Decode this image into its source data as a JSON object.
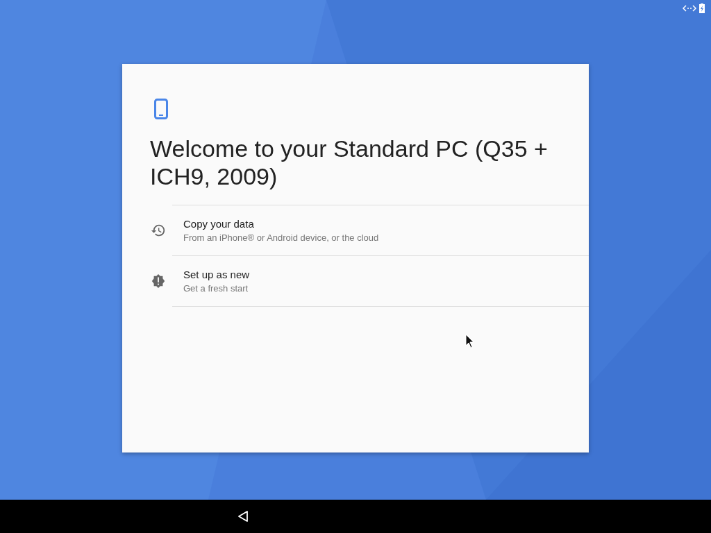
{
  "title": "Welcome to your Standard PC (Q35 + ICH9, 2009)",
  "options": [
    {
      "kind": "history",
      "label": "Copy your data",
      "description": "From an iPhone® or Android device, or the cloud"
    },
    {
      "kind": "new",
      "label": "Set up as new",
      "description": "Get a fresh start"
    }
  ]
}
